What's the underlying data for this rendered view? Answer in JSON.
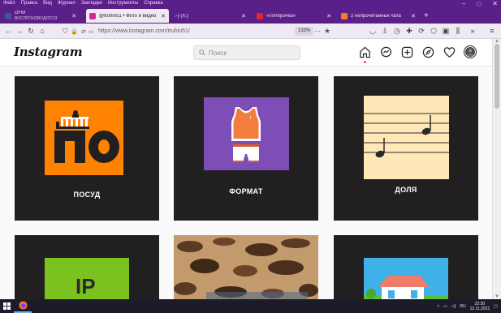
{
  "browser": {
    "menu": [
      "Файл",
      "Правка",
      "Вид",
      "Журнал",
      "Закладки",
      "Инструменты",
      "Справка"
    ],
    "tabs": [
      {
        "title": "DFM",
        "subtitle": "ВОСПРОИЗВОДИТСЯ",
        "color": "#3b5998"
      },
      {
        "title": "@truhin51 • Фото и видео в Inst",
        "color": "#d6249f"
      },
      {
        "title": ":-) (X;)",
        "color": "#999999"
      },
      {
        "title": "«Пятёрочка»",
        "color": "#e3262f"
      },
      {
        "title": "2 непрочитанных чата",
        "color": "#ff7a1a"
      }
    ],
    "new_tab": "+",
    "url": "https://www.instagram.com/truhin51/",
    "zoom": "133%"
  },
  "instagram": {
    "logo": "Instagram",
    "search_placeholder": "Поиск",
    "posts": [
      {
        "label": "ПОСУД"
      },
      {
        "label": "ФОРМАТ"
      },
      {
        "label": "ДОЛЯ"
      },
      {
        "label": "IP"
      }
    ]
  },
  "taskbar": {
    "lang": "RU",
    "time": "22:30",
    "date": "12.11.2021"
  }
}
